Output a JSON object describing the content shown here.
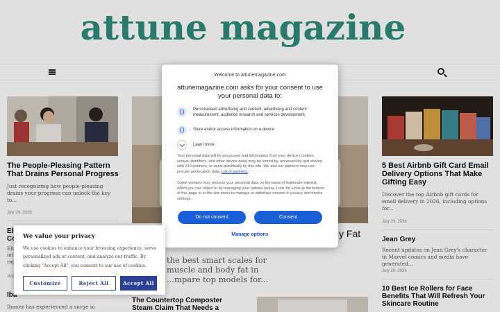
{
  "site": {
    "logo": "attune magazine"
  },
  "articles": [
    {
      "title": "The People-Pleasing Pattern That Drains Personal Progress",
      "excerpt": "Just recognizing how people-pleasing drains your progress can unlock the key to...",
      "date": "July 29, 2026"
    },
    {
      "title": "5 Best Airbnb Gift Card Email Delivery Options That Make Gifting Easy",
      "excerpt": "Discover the top Airbnb gift cards for email delivery in 2026, including options for...",
      "date": "July 29, 2026"
    },
    {
      "title": "Jean Grey",
      "excerpt": "Recent updates on Jean Grey's character in Marvel comics and media have generated...",
      "date": "July 29, 2026"
    },
    {
      "title": "10 Best Ice Rollers for Face Benefits That Will Refresh Your Skincare Routine"
    },
    {
      "title": "The Countertop Composter Steam Claim That Needs a Reality Check"
    },
    {
      "title_fragment": "y Fat",
      "excerpt": "the best smart scales for muscle and body fat in ...mpare top models for..."
    },
    {
      "title_fragment": "Elt Co",
      "excerpt_fragment": "Elt int rep",
      "date_fragment": "July"
    },
    {
      "title_fragment": "Iba",
      "excerpt": "Ibanez has experienced a surge in"
    }
  ],
  "consent_modal": {
    "welcome": "Welcome to attunemagazine.com",
    "heading": "attunemagazine.com asks for your consent to use your personal data to:",
    "purposes": [
      {
        "icon": "person-icon",
        "text": "Personalised advertising and content, advertising and content measurement, audience research and services development"
      },
      {
        "icon": "device-storage-icon",
        "text": "Store and/or access information on a device"
      }
    ],
    "learn_more": "Learn more",
    "info_1": "Your personal data will be processed and information from your device (cookies, unique identifiers, and other device data) may be stored by, accessed by and shared with 210 partners, or used specifically by this site. We and our partners may use precise geolocation data.",
    "partners_link": "List of partners.",
    "info_2": "Some vendors may process your personal data on the basis of legitimate interest, which you can object to by managing your options below. Look for a link at the bottom of this page or in the site menu to manage or withdraw consent in privacy and cookie settings.",
    "do_not_consent": "Do not consent",
    "consent": "Consent",
    "manage_options": "Manage options"
  },
  "privacy_banner": {
    "title": "We value your privacy",
    "text": "We use cookies to enhance your browsing experience, serve personalized ads or content, and analyze our traffic. By clicking \"Accept All\", you consent to our use of cookies.",
    "customize": "Customize",
    "reject_all": "Reject All",
    "accept_all": "Accept All"
  },
  "colors": {
    "logo": "#2e8b7f",
    "consent_blue": "#1a5fd9",
    "privacy_blue": "#2d3f99"
  }
}
